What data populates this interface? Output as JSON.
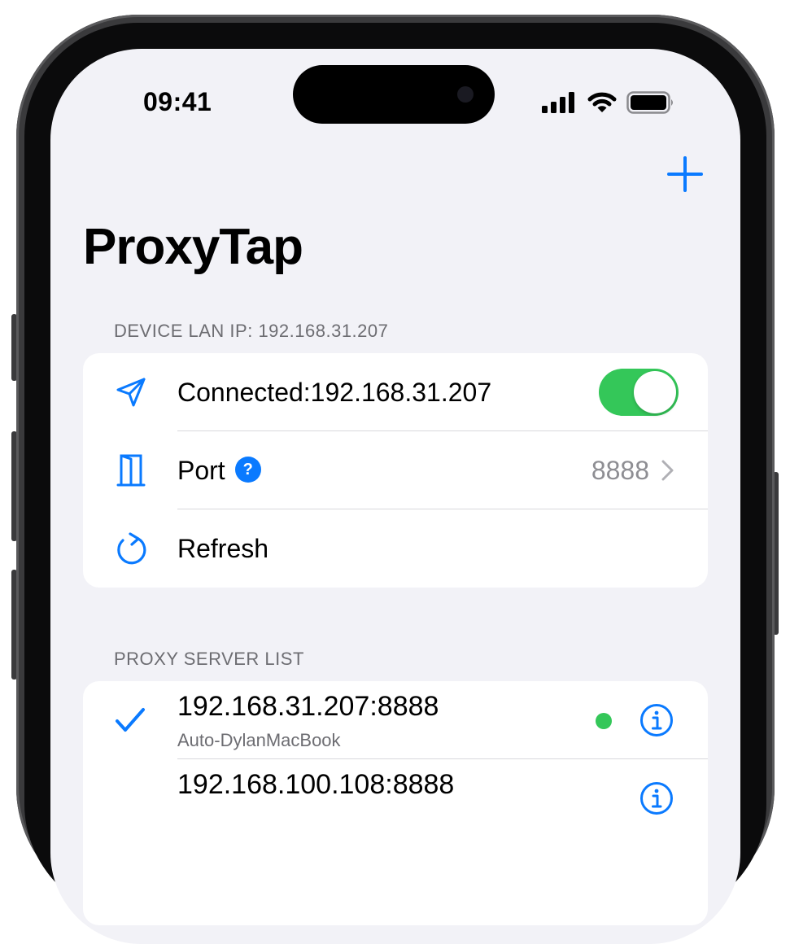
{
  "status_bar": {
    "time": "09:41"
  },
  "nav": {
    "title": "ProxyTap",
    "add_icon": "plus-icon"
  },
  "device_section": {
    "header": "DEVICE LAN IP: 192.168.31.207",
    "connection_label": "Connected:192.168.31.207",
    "connection_enabled": true,
    "port_label": "Port",
    "port_help": "?",
    "port_value": "8888",
    "refresh_label": "Refresh"
  },
  "proxy_section": {
    "header": "PROXY SERVER LIST",
    "servers": [
      {
        "address": "192.168.31.207:8888",
        "name": "Auto-DylanMacBook",
        "selected": true,
        "online": true
      },
      {
        "address": "192.168.100.108:8888",
        "name": "",
        "selected": false,
        "online": false
      }
    ]
  },
  "colors": {
    "accent": "#0a7aff",
    "toggle_on": "#34c759",
    "background": "#f2f2f7",
    "secondary_text": "#6d6d72"
  }
}
